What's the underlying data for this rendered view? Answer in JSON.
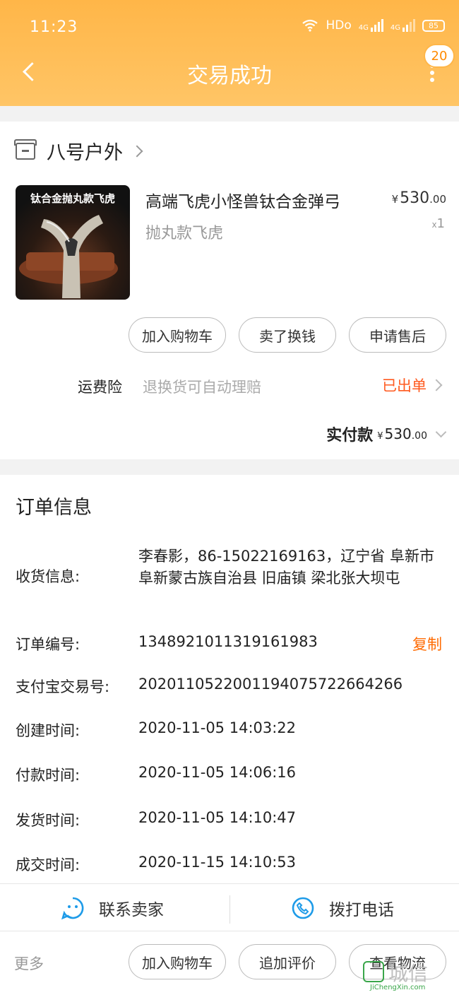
{
  "status_bar": {
    "time": "11:23",
    "network": "HDo",
    "sig1": "4G",
    "sig2": "4G",
    "battery": "85"
  },
  "header": {
    "title": "交易成功",
    "badge_count": "20"
  },
  "store": {
    "name": "八号户外"
  },
  "product": {
    "image_caption": "钛合金抛丸款飞虎",
    "title": "高端飞虎小怪兽钛合金弹弓",
    "spec": "抛丸款飞虎",
    "currency": "¥",
    "price_int": "530",
    "price_dec": ".00",
    "qty_prefix": "x",
    "qty": "1"
  },
  "actions": {
    "add_cart": "加入购物车",
    "sell": "卖了换钱",
    "after_sale": "申请售后"
  },
  "insurance": {
    "label": "运费险",
    "desc": "退换货可自动理赔",
    "status": "已出单"
  },
  "payment": {
    "label": "实付款",
    "currency": "¥",
    "amount_int": "530",
    "amount_dec": ".00"
  },
  "order": {
    "section_title": "订单信息",
    "rows": [
      {
        "label": "收货信息:",
        "value": "李春影，86-15022169163，辽宁省 阜新市 阜新蒙古族自治县 旧庙镇 梁北张大坝屯"
      },
      {
        "label": "订单编号:",
        "value": "1348921011319161983"
      },
      {
        "label": "支付宝交易号:",
        "value": "2020110522001194075722664266"
      },
      {
        "label": "创建时间:",
        "value": "2020-11-05 14:03:22"
      },
      {
        "label": "付款时间:",
        "value": "2020-11-05 14:06:16"
      },
      {
        "label": "发货时间:",
        "value": "2020-11-05 14:10:47"
      },
      {
        "label": "成交时间:",
        "value": "2020-11-15 14:10:53"
      }
    ],
    "copy_label": "复制"
  },
  "contact": {
    "seller": "联系卖家",
    "phone": "拨打电话"
  },
  "bottom": {
    "more": "更多",
    "add_cart": "加入购物车",
    "add_review": "追加评价",
    "logistics": "查看物流"
  },
  "watermark": {
    "main": "城信",
    "sub": "JiChengXin.com"
  },
  "colors": {
    "header": "#ffb648",
    "accent": "#ff5a1f",
    "contact_icon": "#1e9be8"
  }
}
